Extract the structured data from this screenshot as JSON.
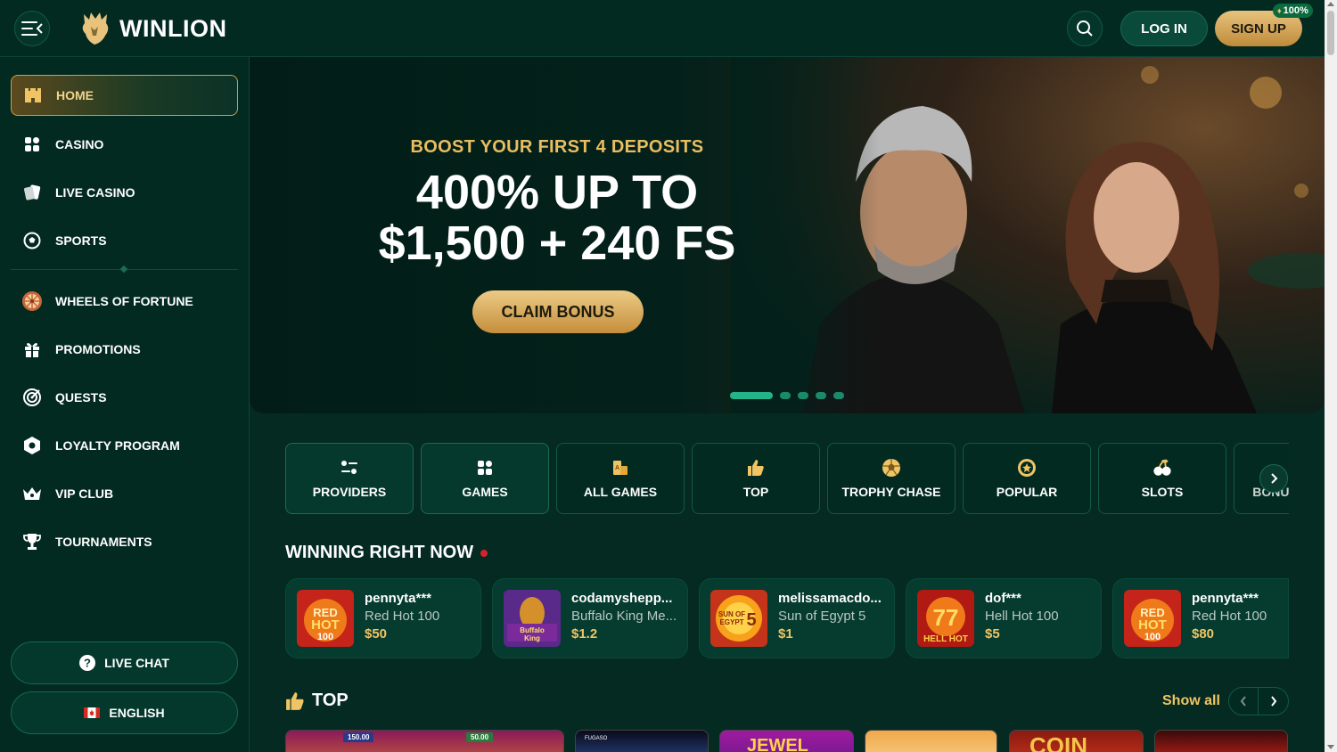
{
  "brand": {
    "name": "WINLION"
  },
  "header": {
    "login_label": "LOG IN",
    "signup_label": "SIGN UP",
    "signup_badge": "100%"
  },
  "sidebar": {
    "items": [
      {
        "label": "HOME",
        "icon": "castle-icon",
        "active": true
      },
      {
        "label": "CASINO",
        "icon": "grid-icon"
      },
      {
        "label": "LIVE CASINO",
        "icon": "cards-icon"
      },
      {
        "label": "SPORTS",
        "icon": "soccer-ball-icon"
      },
      {
        "label": "WHEELS OF FORTUNE",
        "icon": "wheel-icon"
      },
      {
        "label": "PROMOTIONS",
        "icon": "gift-icon"
      },
      {
        "label": "QUESTS",
        "icon": "target-icon"
      },
      {
        "label": "LOYALTY PROGRAM",
        "icon": "hexagon-icon"
      },
      {
        "label": "VIP CLUB",
        "icon": "crown-icon"
      },
      {
        "label": "TOURNAMENTS",
        "icon": "trophy-icon"
      }
    ],
    "live_chat_label": "LIVE CHAT",
    "language_label": "ENGLISH"
  },
  "hero": {
    "kicker": "BOOST YOUR FIRST 4 DEPOSITS",
    "title_line1": "400% UP TO",
    "title_line2": "$1,500 + 240 FS",
    "cta_label": "CLAIM BONUS",
    "slide_count": 5,
    "active_slide": 1
  },
  "categories": [
    {
      "label": "PROVIDERS",
      "icon": "providers-icon"
    },
    {
      "label": "GAMES",
      "icon": "grid-icon"
    },
    {
      "label": "ALL GAMES",
      "icon": "all-games-icon"
    },
    {
      "label": "TOP",
      "icon": "thumbs-up-icon"
    },
    {
      "label": "TROPHY CHASE",
      "icon": "ball-icon"
    },
    {
      "label": "POPULAR",
      "icon": "star-badge-icon"
    },
    {
      "label": "SLOTS",
      "icon": "cherries-icon"
    },
    {
      "label": "BONUS",
      "icon": "bonus-icon"
    }
  ],
  "winning": {
    "title": "WINNING RIGHT NOW",
    "items": [
      {
        "user": "pennyta***",
        "game": "Red Hot 100",
        "amount": "$50"
      },
      {
        "user": "codamyshepp...",
        "game": "Buffalo King Me...",
        "amount": "$1.2"
      },
      {
        "user": "melissamacdo...",
        "game": "Sun of Egypt 5",
        "amount": "$1"
      },
      {
        "user": "dof***",
        "game": "Hell Hot 100",
        "amount": "$5"
      },
      {
        "user": "pennyta***",
        "game": "Red Hot 100",
        "amount": "$80"
      }
    ]
  },
  "top": {
    "title": "TOP",
    "show_all_label": "Show all",
    "tiles": [
      {
        "label": "150.00",
        "label2": "50.00"
      },
      {
        "label": "FUGASO"
      },
      {
        "label": "JEWEL"
      },
      {
        "label": ""
      },
      {
        "label": "COIN"
      },
      {
        "label": ""
      }
    ]
  },
  "colors": {
    "accent_gold": "#f0c464",
    "bg": "#042a22",
    "live_red": "#d4242a"
  }
}
